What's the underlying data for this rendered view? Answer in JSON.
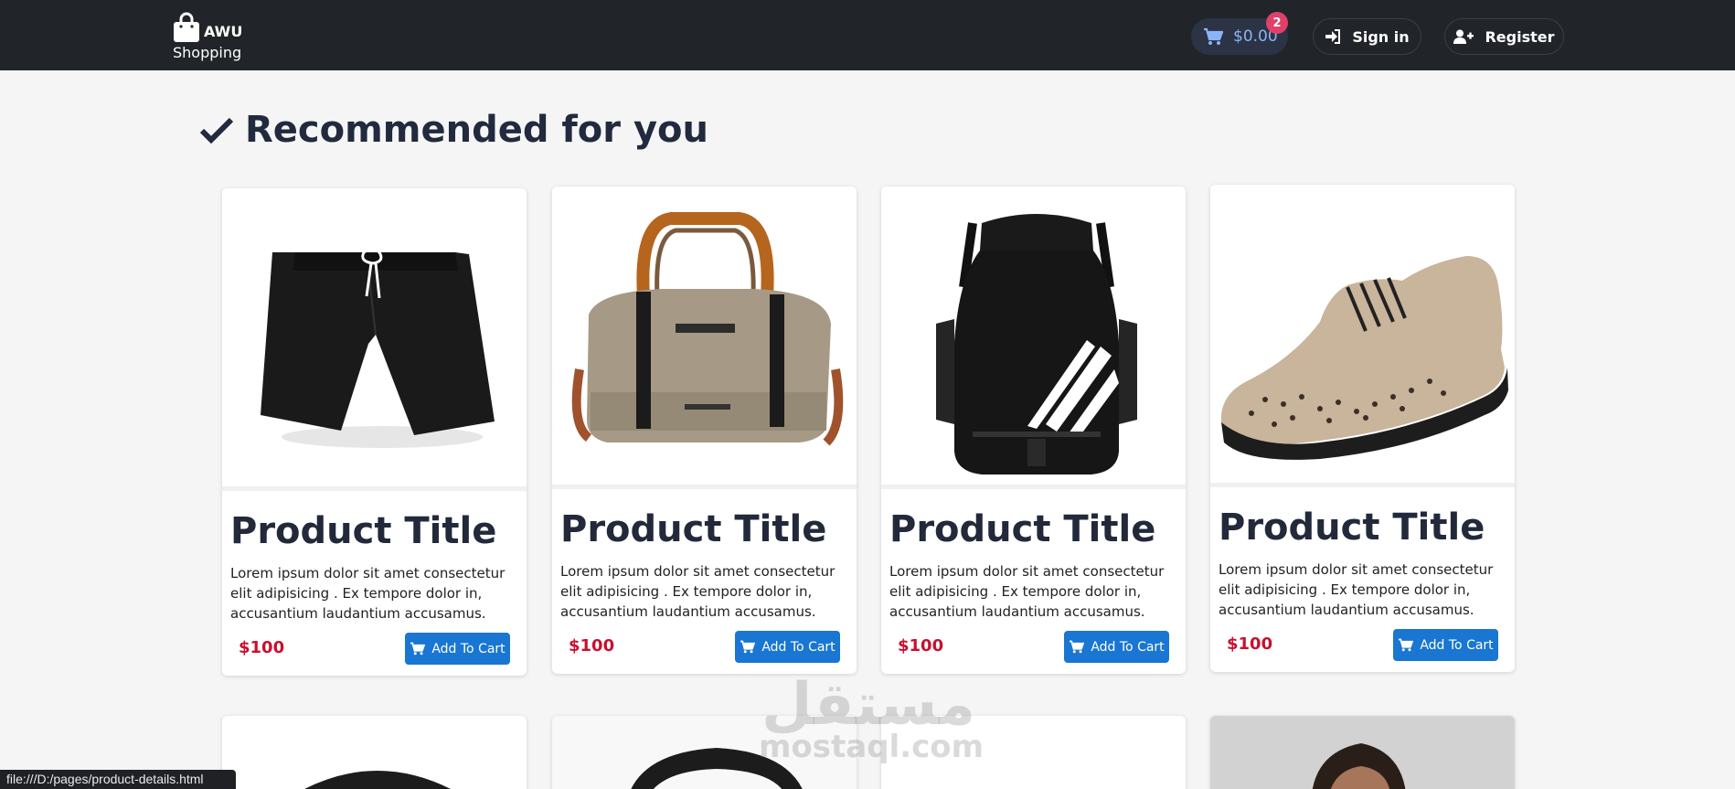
{
  "brand": {
    "name": "AWU",
    "sub": "Shopping"
  },
  "cart": {
    "total": "$0.00",
    "count": "2"
  },
  "nav": {
    "signin_label": "Sign in",
    "register_label": "Register"
  },
  "section": {
    "title": "Recommended for you",
    "icon": "check-icon"
  },
  "products": [
    {
      "title": "Product Title",
      "description": "Lorem ipsum dolor sit amet consectetur elit adipisicing . Ex tempore dolor in, accusantium laudantium accusamus.",
      "price": "$100",
      "button": "Add To Cart",
      "image": "black-shorts"
    },
    {
      "title": "Product Title",
      "description": "Lorem ipsum dolor sit amet consectetur elit adipisicing . Ex tempore dolor in, accusantium laudantium accusamus.",
      "price": "$100",
      "button": "Add To Cart",
      "image": "duffel-bag"
    },
    {
      "title": "Product Title",
      "description": "Lorem ipsum dolor sit amet consectetur elit adipisicing . Ex tempore dolor in, accusantium laudantium accusamus.",
      "price": "$100",
      "button": "Add To Cart",
      "image": "drawstring-backpack"
    },
    {
      "title": "Product Title",
      "description": "Lorem ipsum dolor sit amet consectetur elit adipisicing . Ex tempore dolor in, accusantium laudantium accusamus.",
      "price": "$100",
      "button": "Add To Cart",
      "image": "knit-sneaker"
    }
  ],
  "colors": {
    "navbar": "#212529",
    "accent": "#1976d2",
    "price": "#c8102e",
    "badge": "#e0406a"
  },
  "watermark": {
    "arabic": "مستقل",
    "latin": "mostaql.com"
  },
  "status_bar": {
    "url": "file:///D:/pages/product-details.html"
  }
}
